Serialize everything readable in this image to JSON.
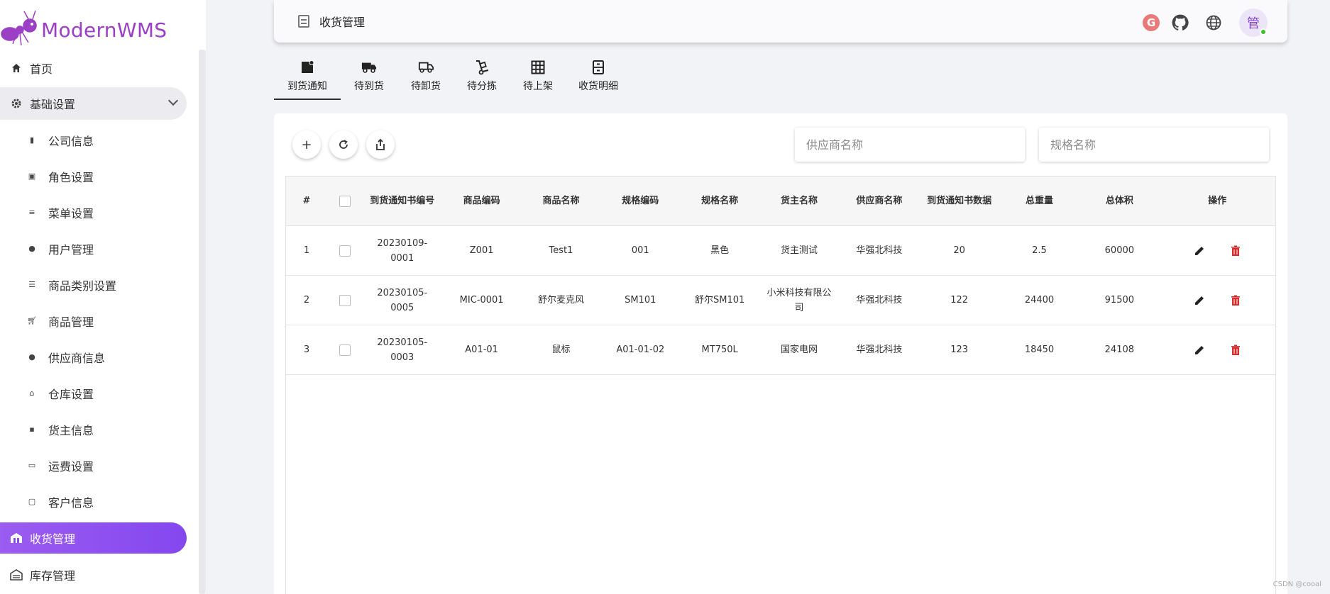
{
  "app": {
    "name": "ModernWMS"
  },
  "sidebar": {
    "items": [
      {
        "label": "首页",
        "icon": "home-icon",
        "type": "top"
      },
      {
        "label": "基础设置",
        "icon": "gear-icon",
        "type": "group"
      },
      {
        "label": "公司信息",
        "icon": "bookmark-icon",
        "type": "sub"
      },
      {
        "label": "角色设置",
        "icon": "id-card-icon",
        "type": "sub"
      },
      {
        "label": "菜单设置",
        "icon": "menu-icon",
        "type": "sub"
      },
      {
        "label": "用户管理",
        "icon": "user-icon",
        "type": "sub"
      },
      {
        "label": "商品类别设置",
        "icon": "list-icon",
        "type": "sub"
      },
      {
        "label": "商品管理",
        "icon": "cart-icon",
        "type": "sub"
      },
      {
        "label": "供应商信息",
        "icon": "supplier-icon",
        "type": "sub"
      },
      {
        "label": "仓库设置",
        "icon": "warehouse-icon",
        "type": "sub"
      },
      {
        "label": "货主信息",
        "icon": "owner-icon",
        "type": "sub"
      },
      {
        "label": "运费设置",
        "icon": "money-icon",
        "type": "sub"
      },
      {
        "label": "客户信息",
        "icon": "customer-icon",
        "type": "sub"
      },
      {
        "label": "收货管理",
        "icon": "receiving-icon",
        "type": "active"
      },
      {
        "label": "库存管理",
        "icon": "warehouse-icon",
        "type": "top"
      }
    ]
  },
  "header": {
    "title": "收货管理",
    "avatar_text": "管"
  },
  "tabs": [
    {
      "label": "到货通知",
      "icon": "note-icon",
      "active": true
    },
    {
      "label": "待到货",
      "icon": "truck-icon",
      "active": false
    },
    {
      "label": "待卸货",
      "icon": "truck-outline-icon",
      "active": false
    },
    {
      "label": "待分拣",
      "icon": "hand-truck-icon",
      "active": false
    },
    {
      "label": "待上架",
      "icon": "grid-icon",
      "active": false
    },
    {
      "label": "收货明细",
      "icon": "file-cabinet-icon",
      "active": false
    }
  ],
  "search": {
    "supplier_placeholder": "供应商名称",
    "spec_placeholder": "规格名称"
  },
  "table": {
    "columns": [
      "#",
      "",
      "到货通知书编号",
      "商品编码",
      "商品名称",
      "规格编码",
      "规格名称",
      "货主名称",
      "供应商名称",
      "到货通知书数据",
      "总重量",
      "总体积",
      "操作"
    ],
    "rows": [
      [
        "1",
        "",
        "20230109-0001",
        "Z001",
        "Test1",
        "001",
        "黑色",
        "货主测试",
        "华强北科技",
        "20",
        "2.5",
        "60000"
      ],
      [
        "2",
        "",
        "20230105-0005",
        "MIC-0001",
        "舒尔麦克风",
        "SM101",
        "舒尔SM101",
        "小米科技有限公司",
        "华强北科技",
        "122",
        "24400",
        "91500"
      ],
      [
        "3",
        "",
        "20230105-0003",
        "A01-01",
        "鼠标",
        "A01-01-02",
        "MT750L",
        "国家电网",
        "华强北科技",
        "123",
        "18450",
        "24108"
      ]
    ]
  },
  "watermark": "CSDN @cooal",
  "colors": {
    "brand": "#9b3fc4",
    "active_nav": "#8a4cf0",
    "delete": "#d32f2f"
  }
}
